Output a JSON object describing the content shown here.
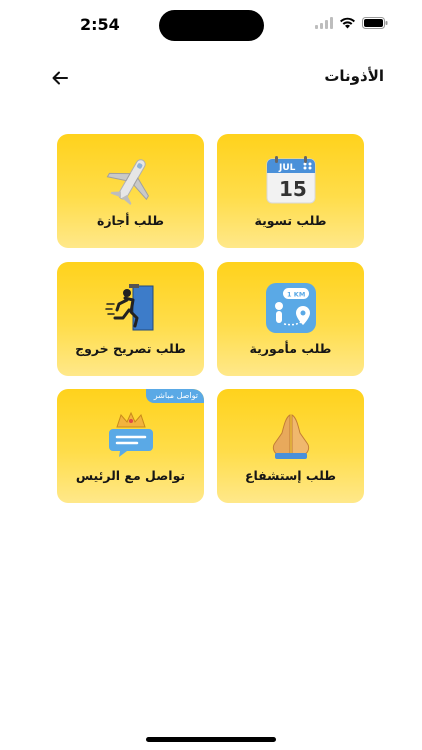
{
  "status_bar": {
    "time": "2:54"
  },
  "header": {
    "title": "الأذونات"
  },
  "tiles": [
    {
      "label": "طلب تسوية",
      "icon": "calendar-icon",
      "calendar_month": "JUL",
      "calendar_day": "15"
    },
    {
      "label": "طلب أجازة",
      "icon": "airplane-icon"
    },
    {
      "label": "طلب مأمورية",
      "icon": "location-route-icon",
      "distance": "1 KM"
    },
    {
      "label": "طلب تصريح خروج",
      "icon": "exit-door-icon"
    },
    {
      "label": "طلب إستشفاع",
      "icon": "praying-hands-icon"
    },
    {
      "label": "تواصل مع الرئيس",
      "icon": "crown-chat-icon",
      "badge": "تواصل مباشر"
    }
  ],
  "colors": {
    "tile_top": "#ffd21c",
    "tile_bottom": "#ffe88a",
    "badge": "#5aa9e6"
  }
}
